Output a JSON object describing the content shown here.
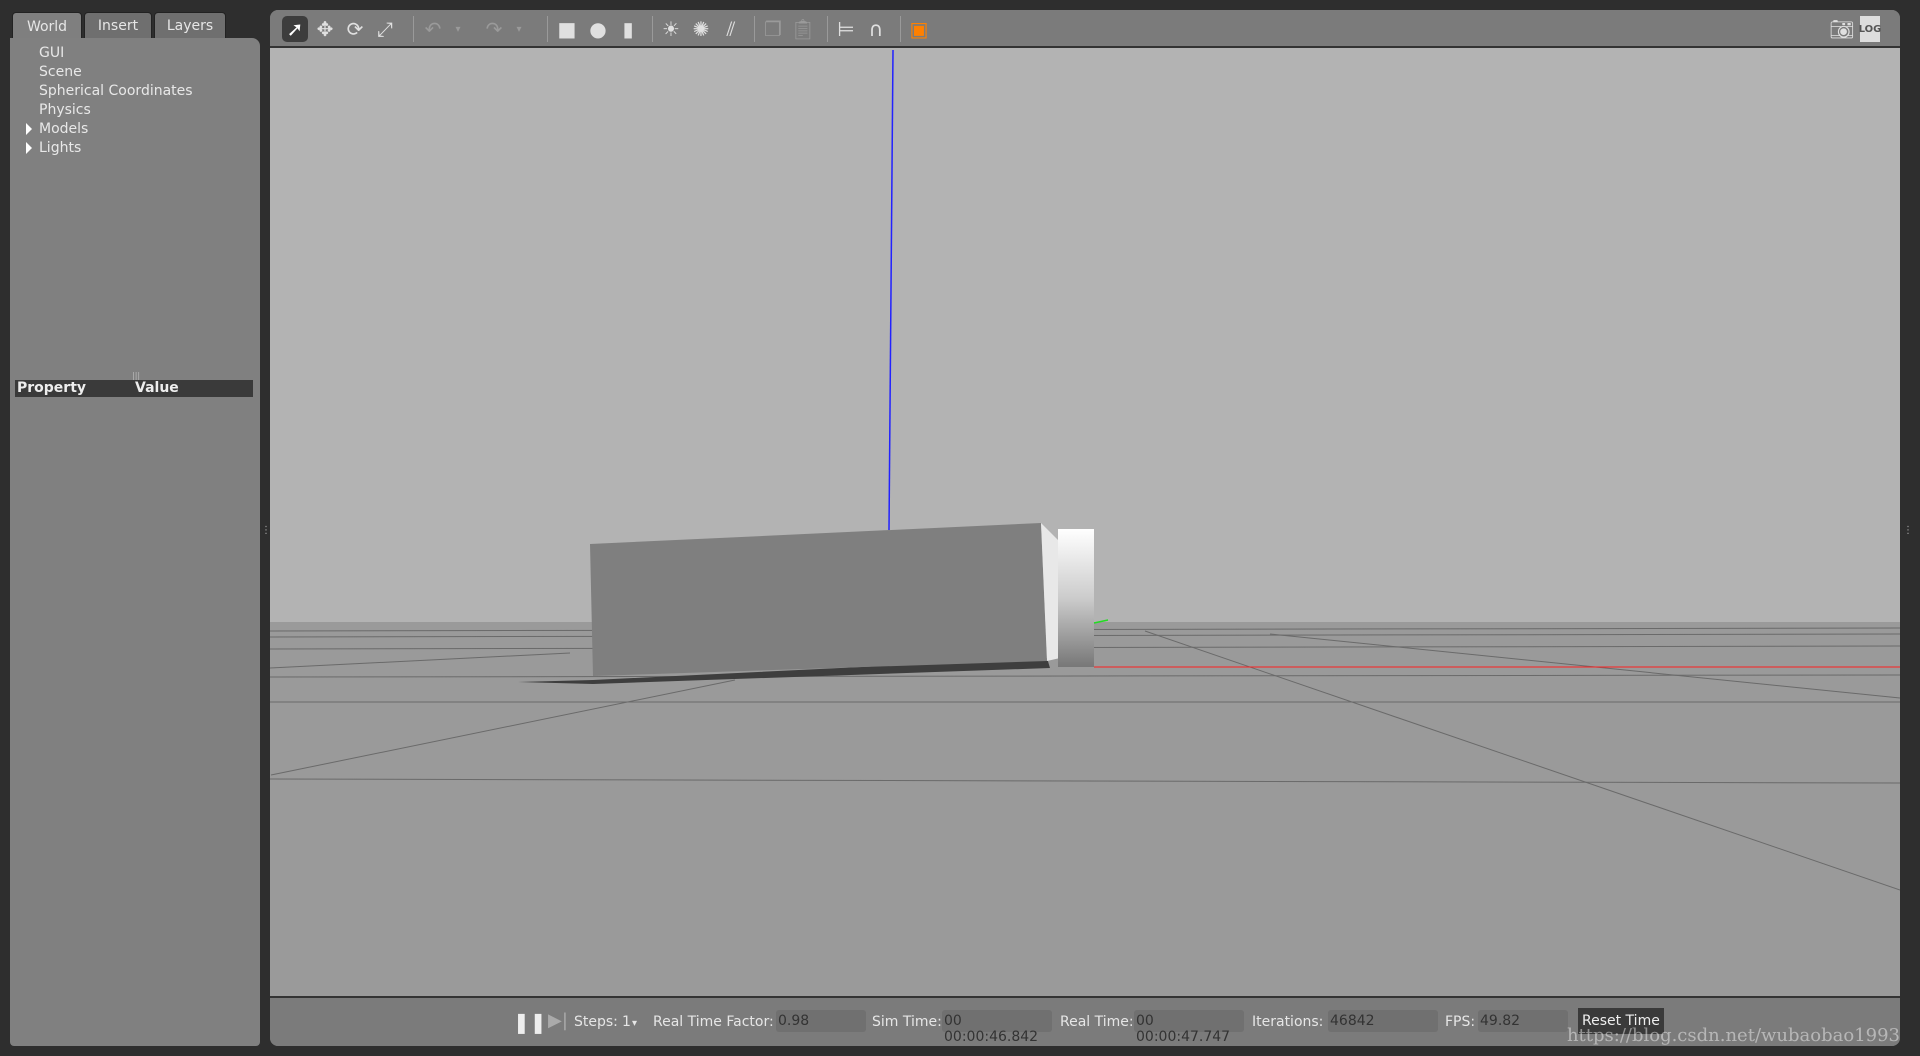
{
  "tabs": [
    {
      "label": "World",
      "active": true
    },
    {
      "label": "Insert"
    },
    {
      "label": "Layers"
    }
  ],
  "tree": [
    {
      "label": "GUI"
    },
    {
      "label": "Scene"
    },
    {
      "label": "Spherical Coordinates"
    },
    {
      "label": "Physics"
    },
    {
      "label": "Models",
      "expandable": true
    },
    {
      "label": "Lights",
      "expandable": true
    }
  ],
  "properties": {
    "col_property": "Property",
    "col_value": "Value"
  },
  "toolbar": {
    "icons": [
      "select-arrow",
      "translate",
      "rotate",
      "scale",
      "undo",
      "undo-dropdown",
      "redo",
      "redo-dropdown",
      "box",
      "sphere",
      "cylinder",
      "point-light",
      "spot-light",
      "directional-light",
      "copy",
      "paste",
      "align",
      "snap",
      "view-angle"
    ],
    "right_icons": [
      "screenshot",
      "log"
    ]
  },
  "bottom": {
    "steps_label": "Steps:",
    "steps_value": "1",
    "rtf_label": "Real Time Factor:",
    "rtf_value": "0.98",
    "sim_label": "Sim Time:",
    "sim_value": "00 00:00:46.842",
    "real_label": "Real Time:",
    "real_value": "00 00:00:47.747",
    "iter_label": "Iterations:",
    "iter_value": "46842",
    "fps_label": "FPS:",
    "fps_value": "49.82",
    "reset_label": "Reset Time"
  },
  "watermark": "https://blog.csdn.net/wubaobao1993",
  "colors": {
    "sky": "#b3b3b3",
    "ground": "#9a9a9a",
    "z_axis": "#2222ff",
    "x_axis": "#ff2020",
    "y_axis": "#22dd22",
    "selected_view_icon": "#ff8000"
  }
}
